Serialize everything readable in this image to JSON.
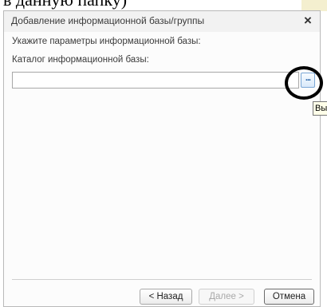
{
  "background": {
    "doc_text": "в данную папку)"
  },
  "dialog": {
    "title": "Добавление информационной базы/группы",
    "close_glyph": "×",
    "prompt": "Укажите параметры информационной базы:",
    "catalog_label": "Каталог информационной базы:",
    "catalog_value": "",
    "browse_label": "...",
    "tooltip": "Вы"
  },
  "buttons": {
    "back": "< Назад",
    "next": "Далее >",
    "cancel": "Отмена"
  },
  "icons": {
    "close": "close-icon"
  }
}
